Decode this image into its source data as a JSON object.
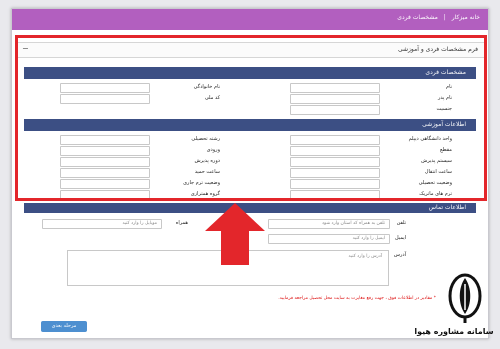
{
  "breadcrumb": {
    "home": "خانه میزکار",
    "sep": "|",
    "current": "مشخصات فردی"
  },
  "panel": {
    "title": "فرم مشخصات فردی و آموزشی",
    "collapse": "−"
  },
  "sections": {
    "personal": "مشخصات فردی",
    "education": "اطلاعات آموزشی",
    "contact": "اطلاعات تماس"
  },
  "personal": {
    "right": [
      "نام",
      "نام پدر",
      "جنسیت"
    ],
    "left": [
      "نام خانوادگی",
      "کد ملی"
    ]
  },
  "education": {
    "right": [
      "واحد دانشگاهی دیپلم",
      "مقطع",
      "سیستم پذیرش",
      "ساعت انتقال",
      "وضعیت تحصیلی",
      "ترم های ماتریک"
    ],
    "left": [
      "رشته تحصیلی",
      "ورودی",
      "دوره پذیرش",
      "ساعت حمید",
      "وضعیت ترم جاری",
      "گروه همترازی"
    ]
  },
  "contact": {
    "phone_label": "تلفن",
    "phone_placeholder": "تلفن به همراه کد استان وارد شود",
    "mobile_label": "همراه",
    "mobile_placeholder": "موبایل را وارد کنید",
    "email_label": "ایمیل",
    "email_placeholder": "ایمیل را وارد کنید",
    "address_label": "آدرس",
    "address_placeholder": "آدرس را وارد کنید"
  },
  "note": "* مقادیر در اطلاعات فوق ، جهت رفع مغایرت به سایت محل تحصیل مراجعه فرمایید.",
  "submit": "مرحله بعدی",
  "logo_text": "سامانه مشاوره هیوا",
  "colors": {
    "topbar": "#b25fbf",
    "section": "#3c4f84",
    "highlight": "#e3262b",
    "button": "#4d8fd0"
  }
}
